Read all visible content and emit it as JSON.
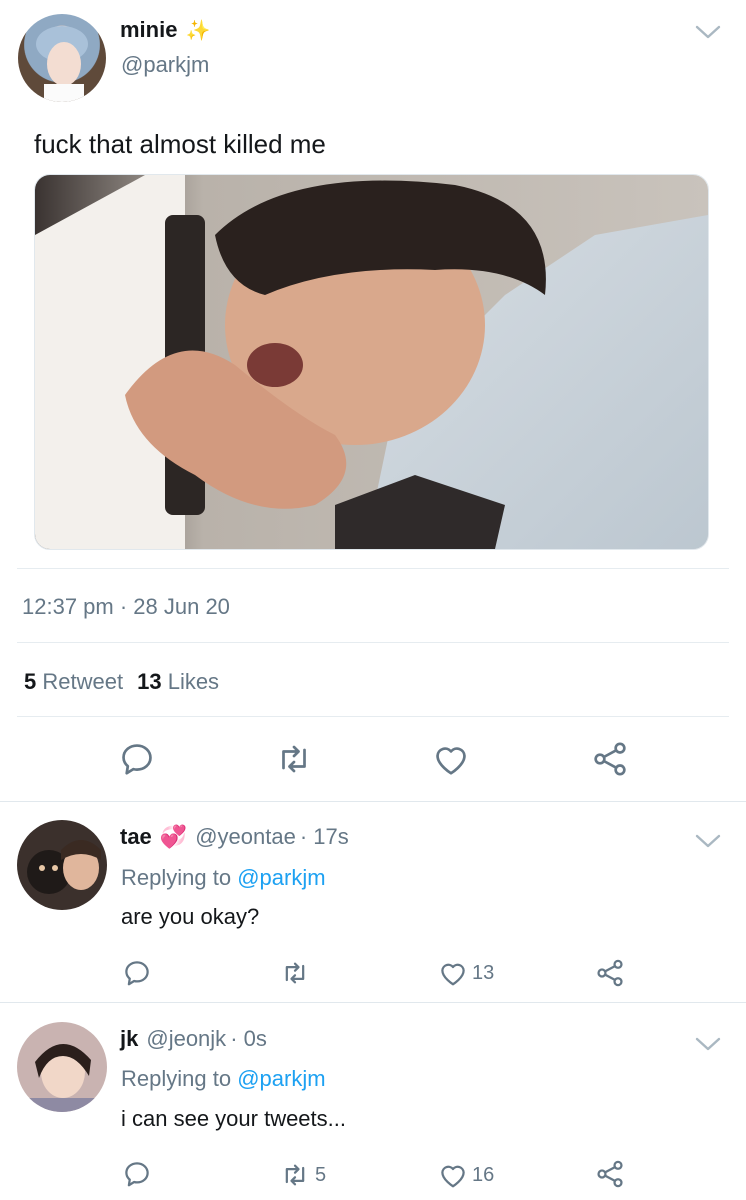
{
  "main_tweet": {
    "display_name": "minie",
    "name_emoji": "✨",
    "handle": "@parkjm",
    "text": "fuck that almost killed me",
    "timestamp": "12:37 pm · 28 Jun 20",
    "retweet_count": "5",
    "retweet_label": "Retweet",
    "like_count": "13",
    "like_label": "Likes"
  },
  "replies": [
    {
      "display_name": "tae",
      "name_emoji": "💞",
      "handle": "@yeontae",
      "time": "· 17s",
      "replying_prefix": "Replying to",
      "replying_handle": "@parkjm",
      "text": "are you okay?",
      "retweets": "",
      "likes": "13"
    },
    {
      "display_name": "jk",
      "name_emoji": "",
      "handle": "@jeonjk",
      "time": "· 0s",
      "replying_prefix": "Replying to",
      "replying_handle": "@parkjm",
      "text": "i can see your tweets...",
      "retweets": "5",
      "likes": "16"
    }
  ],
  "colors": {
    "accent": "#1da1f2",
    "muted": "#657786",
    "divider": "#e6ecf0",
    "sparkle": "#ffc94b",
    "heart_emoji": "#e0245e"
  },
  "icons": [
    "chevron-down-icon",
    "reply-icon",
    "retweet-icon",
    "like-icon",
    "share-icon"
  ]
}
